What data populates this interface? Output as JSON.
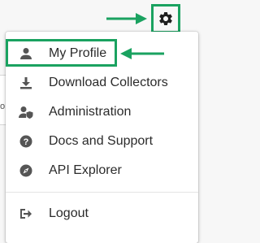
{
  "header": {
    "settings_icon": "gear-icon",
    "annotation_color": "#1aa260"
  },
  "backdrop": {
    "fragment": "o"
  },
  "menu": {
    "items": [
      {
        "label": "My Profile",
        "icon": "user-icon",
        "highlighted": true
      },
      {
        "label": "Download Collectors",
        "icon": "download-icon"
      },
      {
        "label": "Administration",
        "icon": "admin-shield-icon"
      },
      {
        "label": "Docs and Support",
        "icon": "help-icon"
      },
      {
        "label": "API Explorer",
        "icon": "compass-icon"
      },
      {
        "label": "Logout",
        "icon": "logout-icon"
      }
    ]
  }
}
